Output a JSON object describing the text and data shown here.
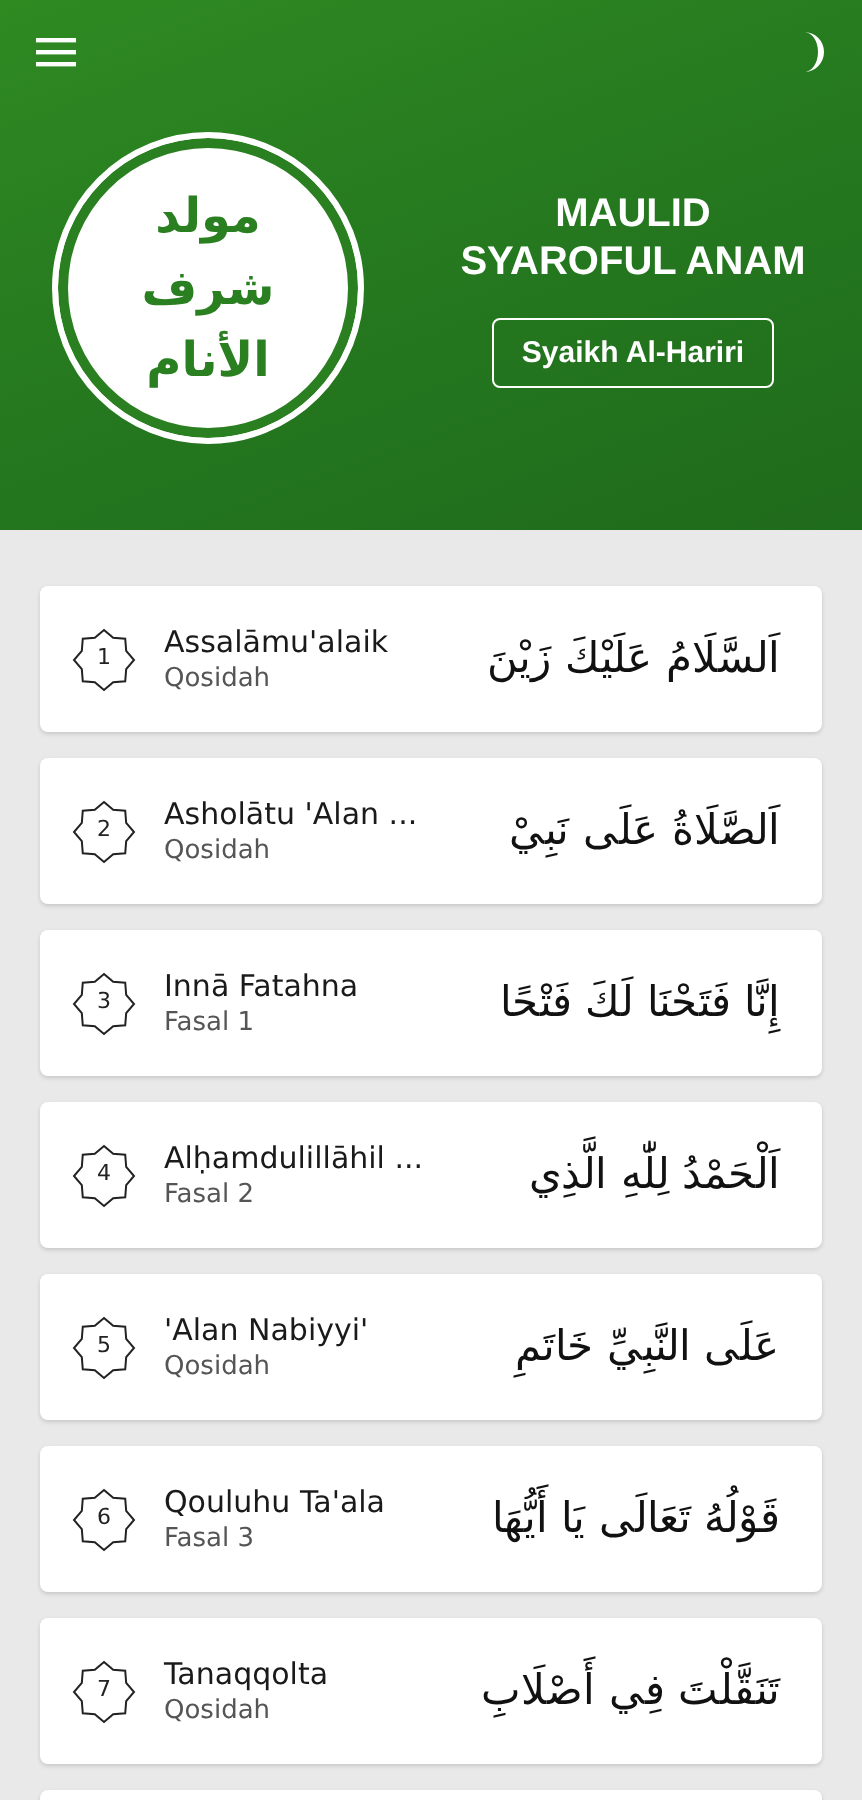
{
  "header": {
    "logo_text": "مولد شرف الأنام",
    "title": "MAULID SYAROFUL ANAM",
    "author_button": "Syaikh Al-Hariri"
  },
  "chapters": [
    {
      "number": "1",
      "title": "Assalāmu'alaik",
      "subtitle": "Qosidah",
      "arabic": "اَلسَّلَامُ عَلَيْكَ زَيْنَ"
    },
    {
      "number": "2",
      "title": "Asholātu 'Alan ...",
      "subtitle": "Qosidah",
      "arabic": "اَلصَّلَاةُ عَلَى نَبِيْ"
    },
    {
      "number": "3",
      "title": "Innā Fatahna",
      "subtitle": "Fasal 1",
      "arabic": "إِنَّا فَتَحْنَا لَكَ فَتْحًا"
    },
    {
      "number": "4",
      "title": "Alḥamdulillāhil ...",
      "subtitle": "Fasal 2",
      "arabic": "اَلْحَمْدُ لِلّٰهِ الَّذِي"
    },
    {
      "number": "5",
      "title": "'Alan Nabiyyi'",
      "subtitle": "Qosidah",
      "arabic": "عَلَى النَّبِيِّ خَاتَمِ"
    },
    {
      "number": "6",
      "title": "Qouluhu Ta'ala",
      "subtitle": "Fasal 3",
      "arabic": "قَوْلُهُ تَعَالَى يَا أَيُّهَا"
    },
    {
      "number": "7",
      "title": "Tanaqqolta",
      "subtitle": "Qosidah",
      "arabic": "تَنَقَّلْتَ فِي أَصْلَابِ"
    }
  ]
}
